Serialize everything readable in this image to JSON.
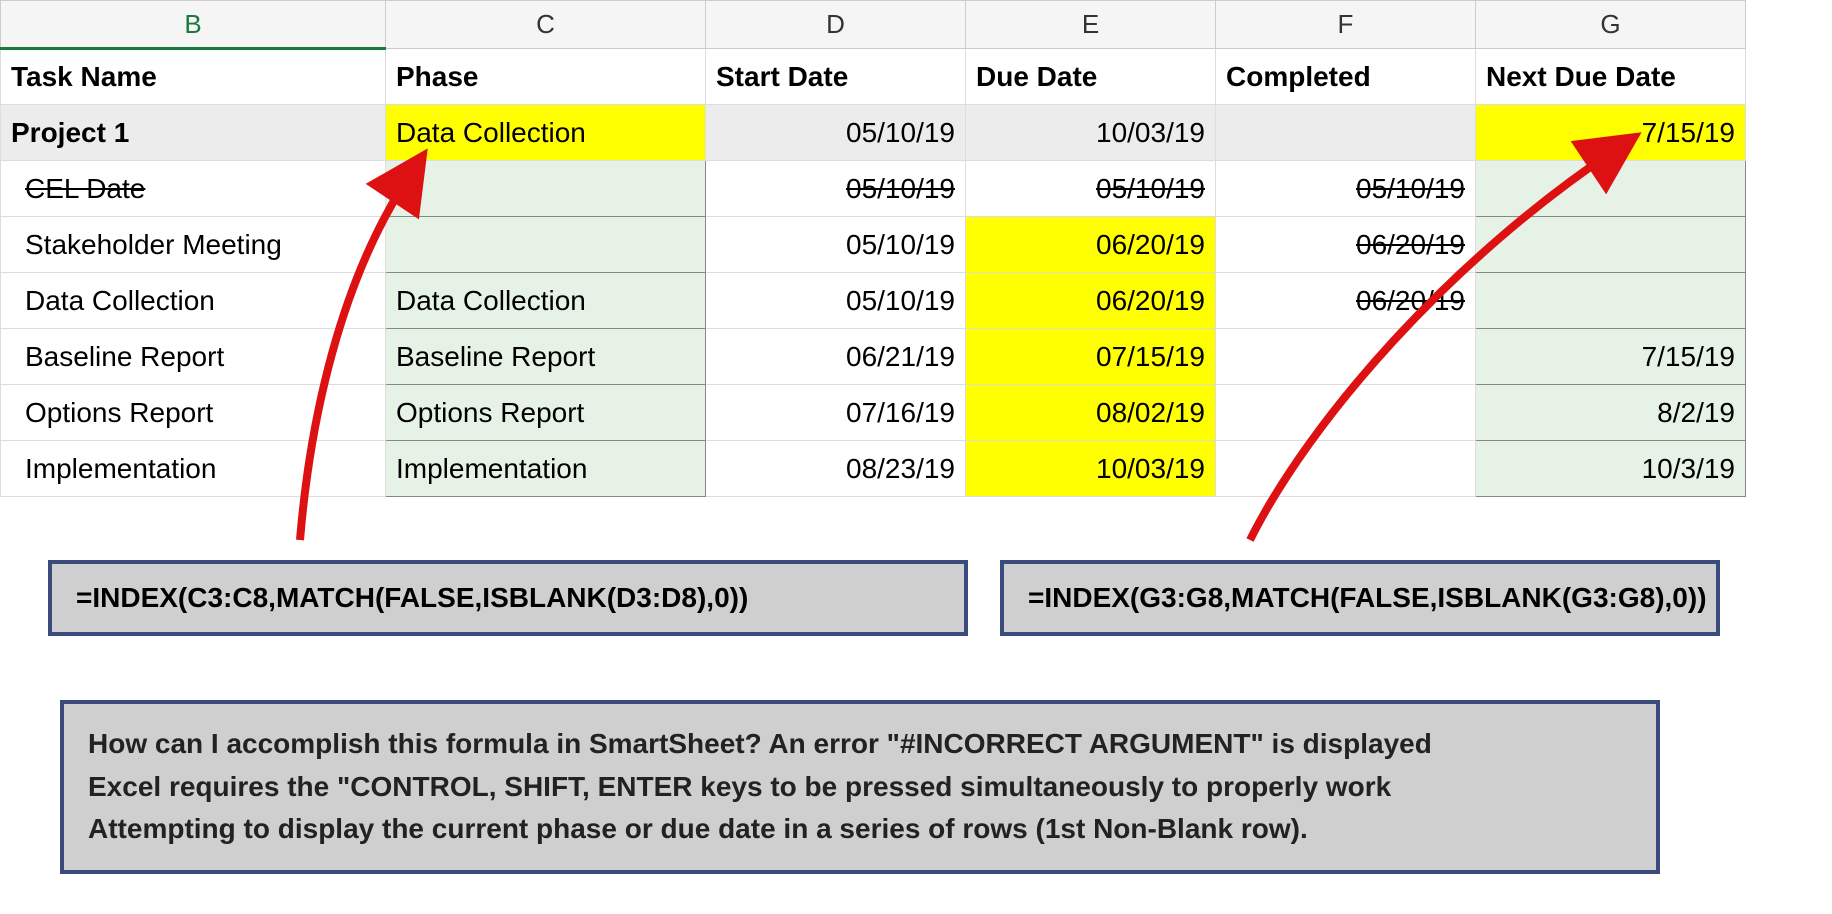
{
  "columns": {
    "B": "B",
    "C": "C",
    "D": "D",
    "E": "E",
    "F": "F",
    "G": "G"
  },
  "headers": {
    "task": "Task Name",
    "phase": "Phase",
    "start": "Start  Date",
    "due": "Due Date",
    "completed": "Completed",
    "nextdue": "Next Due Date"
  },
  "rows": [
    {
      "task": "Project 1",
      "phase": "Data Collection",
      "start": "05/10/19",
      "due": "10/03/19",
      "completed": "",
      "nextdue": "7/15/19",
      "type": "project"
    },
    {
      "task": "CEL Date",
      "phase": "",
      "start": "05/10/19",
      "due": "05/10/19",
      "completed": "05/10/19",
      "nextdue": "",
      "type": "strike"
    },
    {
      "task": "Stakeholder Meeting",
      "phase": "",
      "start": "05/10/19",
      "due": "06/20/19",
      "completed": "06/20/19",
      "nextdue": "",
      "type": "normal",
      "dueYellow": true,
      "compStrike": true
    },
    {
      "task": "Data Collection",
      "phase": "Data Collection",
      "start": "05/10/19",
      "due": "06/20/19",
      "completed": "06/20/19",
      "nextdue": "",
      "type": "normal",
      "dueYellow": true,
      "compStrike": true
    },
    {
      "task": "Baseline Report",
      "phase": "Baseline Report",
      "start": "06/21/19",
      "due": "07/15/19",
      "completed": "",
      "nextdue": "7/15/19",
      "type": "normal",
      "dueYellow": true
    },
    {
      "task": "Options Report",
      "phase": "Options Report",
      "start": "07/16/19",
      "due": "08/02/19",
      "completed": "",
      "nextdue": "8/2/19",
      "type": "normal",
      "dueYellow": true
    },
    {
      "task": "Implementation",
      "phase": "Implementation",
      "start": "08/23/19",
      "due": "10/03/19",
      "completed": "",
      "nextdue": "10/3/19",
      "type": "normal",
      "dueYellow": true
    }
  ],
  "formulas": {
    "left": "=INDEX(C3:C8,MATCH(FALSE,ISBLANK(D3:D8),0))",
    "right": "=INDEX(G3:G8,MATCH(FALSE,ISBLANK(G3:G8),0))"
  },
  "question": {
    "l1": "How can I accomplish this formula in SmartSheet? An error \"#INCORRECT ARGUMENT\" is displayed",
    "l2": "Excel requires the \"CONTROL, SHIFT, ENTER keys to be pressed simultaneously to properly work",
    "l3": "Attempting to display the current phase or due date in a series of rows (1st Non-Blank row)."
  }
}
